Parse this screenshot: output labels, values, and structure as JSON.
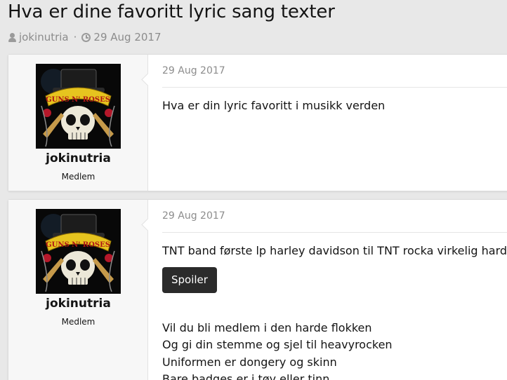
{
  "thread": {
    "title": "Hva er dine favoritt lyric sang texter",
    "author": "jokinutria",
    "date": "29 Aug 2017",
    "separator": "·"
  },
  "icons": {
    "author": "user-icon",
    "date": "clock-icon"
  },
  "colors": {
    "page_bg": "#e8e8e8",
    "card_bg": "#ffffff",
    "user_panel_bg": "#f7f7f7",
    "muted_text": "#8c8c8c",
    "button_bg": "#2b2b2b"
  },
  "posts": [
    {
      "username": "jokinutria",
      "user_title": "Medlem",
      "date": "29 Aug 2017",
      "text": "Hva er din lyric favoritt i musikk verden"
    },
    {
      "username": "jokinutria",
      "user_title": "Medlem",
      "date": "29 Aug 2017",
      "text": "TNT band første lp harley davidson til TNT rocka virkelig hard.",
      "spoiler_label": "Spoiler",
      "lyrics": [
        "Vil du bli medlem i den harde flokken",
        "Og gi din stemme og sjel til heavyrocken",
        "Uniformen er dongery og skinn",
        "Bare badges er i tøy eller tinn"
      ]
    }
  ],
  "avatar": {
    "banner_text": "GUNS N' ROSES",
    "image": "guns-n-roses-skull-logo"
  }
}
